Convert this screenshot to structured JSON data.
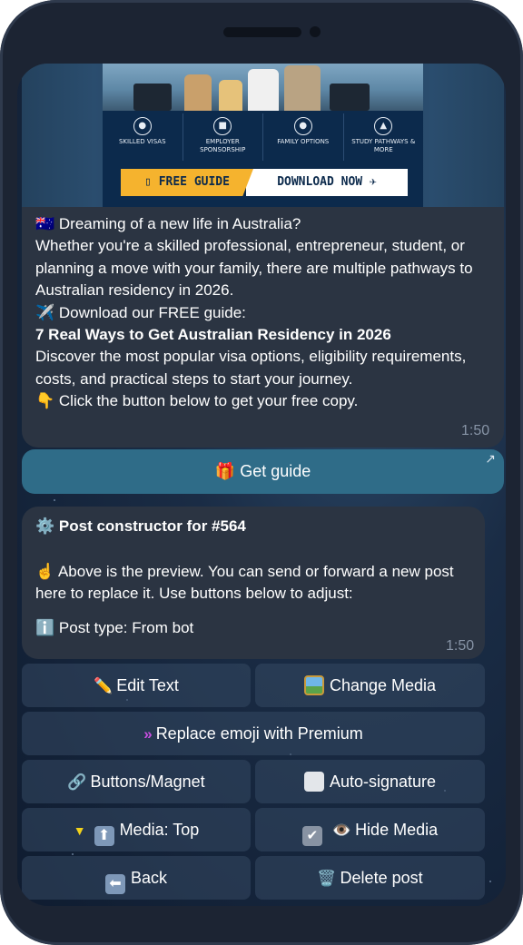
{
  "message": {
    "banner": {
      "features": [
        "SKILLED VISAS",
        "EMPLOYER SPONSORSHIP",
        "FAMILY OPTIONS",
        "STUDY PATHWAYS & MORE"
      ],
      "free_guide": "FREE GUIDE",
      "download_now": "DOWNLOAD NOW"
    },
    "lines": [
      "🇦🇺 Dreaming of a new life in Australia?",
      "Whether you're a skilled professional, entrepreneur, student, or planning a move with your family, there are multiple pathways to Australian residency in 2026.",
      "✈️ Download our FREE guide:",
      "7 Real Ways to Get Australian Residency in 2026",
      "Discover the most popular visa options, eligibility requirements, costs, and practical steps to start your journey.",
      "👇 Click the button below to get your free copy."
    ],
    "time": "1:50"
  },
  "inline_button": {
    "emoji": "🎁",
    "label": "Get guide",
    "external_icon": "↗"
  },
  "constructor": {
    "title": "Post constructor for #564",
    "title_icon": "gear-icon",
    "body": "Above is the preview. You can send or forward a new post here to replace it. Use buttons below to adjust:",
    "post_type": "Post type: From bot",
    "time": "1:50"
  },
  "keyboard": {
    "edit_text": "Edit Text",
    "change_media": "Change Media",
    "replace_emoji": "Replace emoji with Premium",
    "buttons_magnet": "Buttons/Magnet",
    "auto_signature": "Auto-signature",
    "media_top": "Media: Top",
    "hide_media": "Hide Media",
    "back": "Back",
    "delete_post": "Delete post"
  },
  "colors": {
    "bubble": "#2b3442",
    "inline_button": "#2f6c88",
    "keyboard_button": "#344862",
    "accent_yellow": "#f5b32e",
    "banner_navy": "#0c2a4c"
  }
}
